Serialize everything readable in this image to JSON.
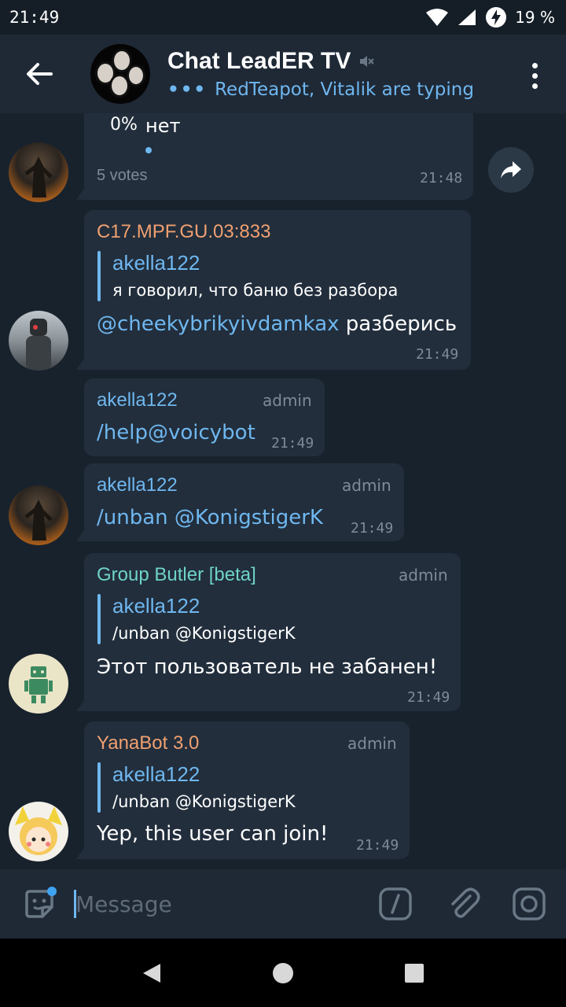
{
  "status": {
    "time": "21:49",
    "battery": "19 %"
  },
  "header": {
    "title": "Chat LeadER TV",
    "typing": "RedTeapot, Vitalik are typing",
    "typing_dots": "•••"
  },
  "poll": {
    "option_percent": "0%",
    "option_label": "нет",
    "votes": "5 votes",
    "time": "21:48"
  },
  "messages": [
    {
      "sender": "C17.MPF.GU.03:833",
      "reply_name": "akella122",
      "reply_text": "я говорил, что баню без разбора",
      "mention": "@cheekybrikyivdamkax",
      "text": " разберись",
      "time": "21:49"
    },
    {
      "sender": "akella122",
      "badge": "admin",
      "text": "/help@voicybot",
      "time": "21:49"
    },
    {
      "sender": "akella122",
      "badge": "admin",
      "text": "/unban @KonigstigerK",
      "time": "21:49"
    },
    {
      "sender": "Group Butler [beta]",
      "badge": "admin",
      "reply_name": "akella122",
      "reply_text": "/unban @KonigstigerK",
      "text": "Этот пользователь не забанен!",
      "time": "21:49"
    },
    {
      "sender": "YanaBot 3.0",
      "badge": "admin",
      "reply_name": "akella122",
      "reply_text": "/unban @KonigstigerK",
      "text": "Yep, this user can join!",
      "time": "21:49"
    }
  ],
  "composer": {
    "placeholder": "Message"
  },
  "colors": {
    "accent": "#6fb7ef",
    "sender_orange": "#f0a070",
    "sender_teal": "#6fd3c8",
    "bubble": "#222e3c",
    "background": "#18222d"
  }
}
